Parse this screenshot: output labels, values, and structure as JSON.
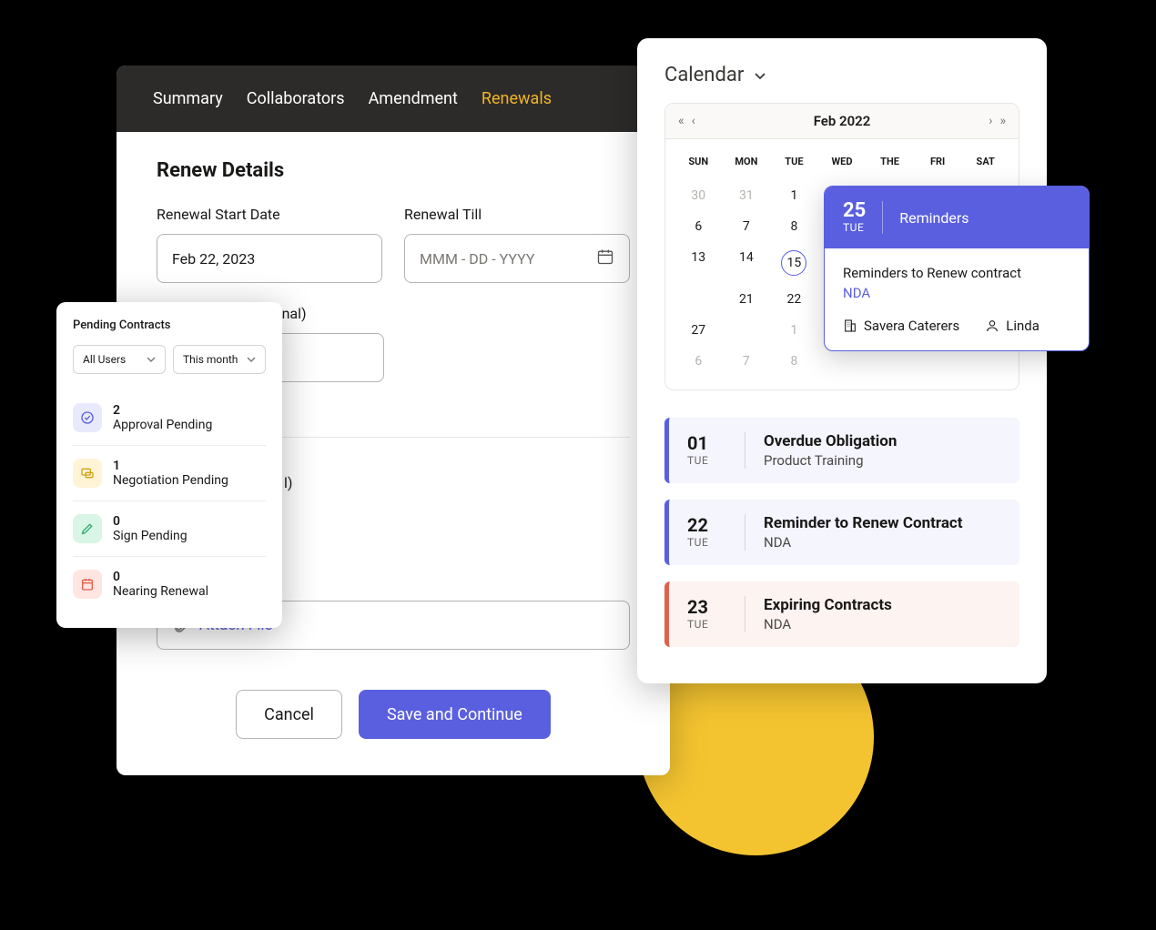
{
  "tabs": [
    "Summary",
    "Collaborators",
    "Amendment",
    "Renewals"
  ],
  "active_tab": "Renewals",
  "renewal": {
    "title": "Renew Details",
    "start_label": "Renewal Start Date",
    "start_value": "Feb 22, 2023",
    "till_label": "Renewal Till",
    "till_placeholder": "MMM  -  DD   -  YYYY",
    "fee_label": "Renewal Fee (Optional)",
    "other_field_suffix": "l)",
    "attach": "Attach File",
    "cancel": "Cancel",
    "save": "Save and Continue"
  },
  "pending": {
    "title": "Pending Contracts",
    "filter_users": "All Users",
    "filter_period": "This month",
    "items": [
      {
        "count": "2",
        "label": "Approval Pending",
        "color": "purple",
        "icon": "check-circle-icon"
      },
      {
        "count": "1",
        "label": "Negotiation Pending",
        "color": "yellow",
        "icon": "chat-icon"
      },
      {
        "count": "0",
        "label": "Sign Pending",
        "color": "green",
        "icon": "pen-icon"
      },
      {
        "count": "0",
        "label": "Nearing Renewal",
        "color": "red",
        "icon": "calendar-icon"
      }
    ]
  },
  "calendar": {
    "title": "Calendar",
    "month": "Feb 2022",
    "dow": [
      "SUN",
      "MON",
      "TUE",
      "WED",
      "THE",
      "FRI",
      "SAT"
    ],
    "weeks": [
      [
        {
          "d": "30",
          "m": true
        },
        {
          "d": "31",
          "m": true
        },
        {
          "d": "1"
        },
        {
          "d": ""
        },
        {
          "d": ""
        },
        {
          "d": ""
        },
        {
          "d": ""
        }
      ],
      [
        {
          "d": "6"
        },
        {
          "d": "7"
        },
        {
          "d": "8"
        },
        {
          "d": ""
        },
        {
          "d": ""
        },
        {
          "d": ""
        },
        {
          "d": ""
        }
      ],
      [
        {
          "d": "13"
        },
        {
          "d": "14"
        },
        {
          "d": "15",
          "sel": true
        },
        {
          "d": ""
        },
        {
          "d": ""
        },
        {
          "d": ""
        },
        {
          "d": ""
        }
      ],
      [
        {
          "d": ""
        },
        {
          "d": "21"
        },
        {
          "d": "22"
        },
        {
          "d": ""
        },
        {
          "d": ""
        },
        {
          "d": ""
        },
        {
          "d": ""
        }
      ],
      [
        {
          "d": "27"
        },
        {
          "d": ""
        },
        {
          "d": "1",
          "m": true
        },
        {
          "d": ""
        },
        {
          "d": ""
        },
        {
          "d": ""
        },
        {
          "d": ""
        }
      ],
      [
        {
          "d": "6",
          "m": true
        },
        {
          "d": "7",
          "m": true
        },
        {
          "d": "8",
          "m": true
        },
        {
          "d": ""
        },
        {
          "d": ""
        },
        {
          "d": ""
        },
        {
          "d": ""
        }
      ]
    ]
  },
  "popover": {
    "day": "25",
    "dow": "TUE",
    "header": "Reminders",
    "text": "Reminders to Renew contract",
    "link": "NDA",
    "company": "Savera Caterers",
    "person": "Linda"
  },
  "events": [
    {
      "day": "01",
      "dow": "TUE",
      "title": "Overdue Obligation",
      "sub": "Product Training",
      "style": "normal"
    },
    {
      "day": "22",
      "dow": "TUE",
      "title": "Reminder to Renew Contract",
      "sub": "NDA",
      "style": "normal"
    },
    {
      "day": "23",
      "dow": "TUE",
      "title": "Expiring Contracts",
      "sub": "NDA",
      "style": "warn"
    }
  ]
}
